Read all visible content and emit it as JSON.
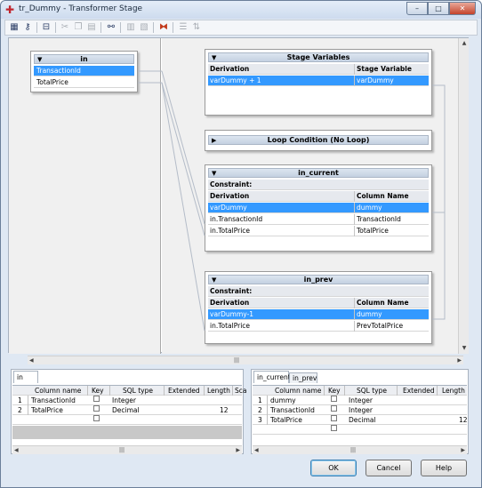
{
  "window": {
    "title": "tr_Dummy - Transformer Stage",
    "min": "–",
    "max": "□",
    "close": "✕"
  },
  "toolbar": {
    "icons": [
      "stage-properties-icon",
      "constraints-icon",
      "show-all-icon",
      "cut-icon",
      "copy-icon",
      "paste-icon",
      "find-replace-icon",
      "load-column-icon",
      "save-column-icon",
      "column-autocomplete-icon",
      "input-link-order-icon",
      "output-link-order-icon"
    ]
  },
  "input_link": {
    "name": "in",
    "rows": [
      "TransactionId",
      "TotalPrice"
    ]
  },
  "stage_vars": {
    "title": "Stage Variables",
    "col1": "Derivation",
    "col2": "Stage Variable",
    "rows": [
      {
        "d": "varDummy + 1",
        "v": "varDummy"
      }
    ]
  },
  "loop": {
    "title": "Loop Condition (No Loop)"
  },
  "in_current": {
    "title": "in_current",
    "constraint": "Constraint:",
    "col1": "Derivation",
    "col2": "Column Name",
    "rows": [
      {
        "d": "varDummy",
        "c": "dummy"
      },
      {
        "d": "in.TransactionId",
        "c": "TransactionId"
      },
      {
        "d": "in.TotalPrice",
        "c": "TotalPrice"
      }
    ]
  },
  "in_prev": {
    "title": "in_prev",
    "constraint": "Constraint:",
    "col1": "Derivation",
    "col2": "Column Name",
    "rows": [
      {
        "d": "varDummy-1",
        "c": "dummy"
      },
      {
        "d": "in.TotalPrice",
        "c": "PrevTotalPrice"
      }
    ]
  },
  "left_grid": {
    "tab": "in",
    "headers": [
      "Column name",
      "Key",
      "SQL type",
      "Extended",
      "Length",
      "Sca"
    ],
    "rows": [
      {
        "n": "1",
        "name": "TransactionId",
        "type": "Integer",
        "len": ""
      },
      {
        "n": "2",
        "name": "TotalPrice",
        "type": "Decimal",
        "len": "12"
      }
    ]
  },
  "right_grid": {
    "tabs": [
      "in_current",
      "in_prev"
    ],
    "headers": [
      "Column name",
      "Key",
      "SQL type",
      "Extended",
      "Length"
    ],
    "rows": [
      {
        "n": "1",
        "name": "dummy",
        "type": "Integer",
        "len": ""
      },
      {
        "n": "2",
        "name": "TransactionId",
        "type": "Integer",
        "len": ""
      },
      {
        "n": "3",
        "name": "TotalPrice",
        "type": "Decimal",
        "len": "12"
      }
    ]
  },
  "scroll": {
    "grip": "|||",
    "up": "▲",
    "down": "▼",
    "left": "◀",
    "right": "▶"
  },
  "buttons": {
    "ok": "OK",
    "cancel": "Cancel",
    "help": "Help"
  }
}
